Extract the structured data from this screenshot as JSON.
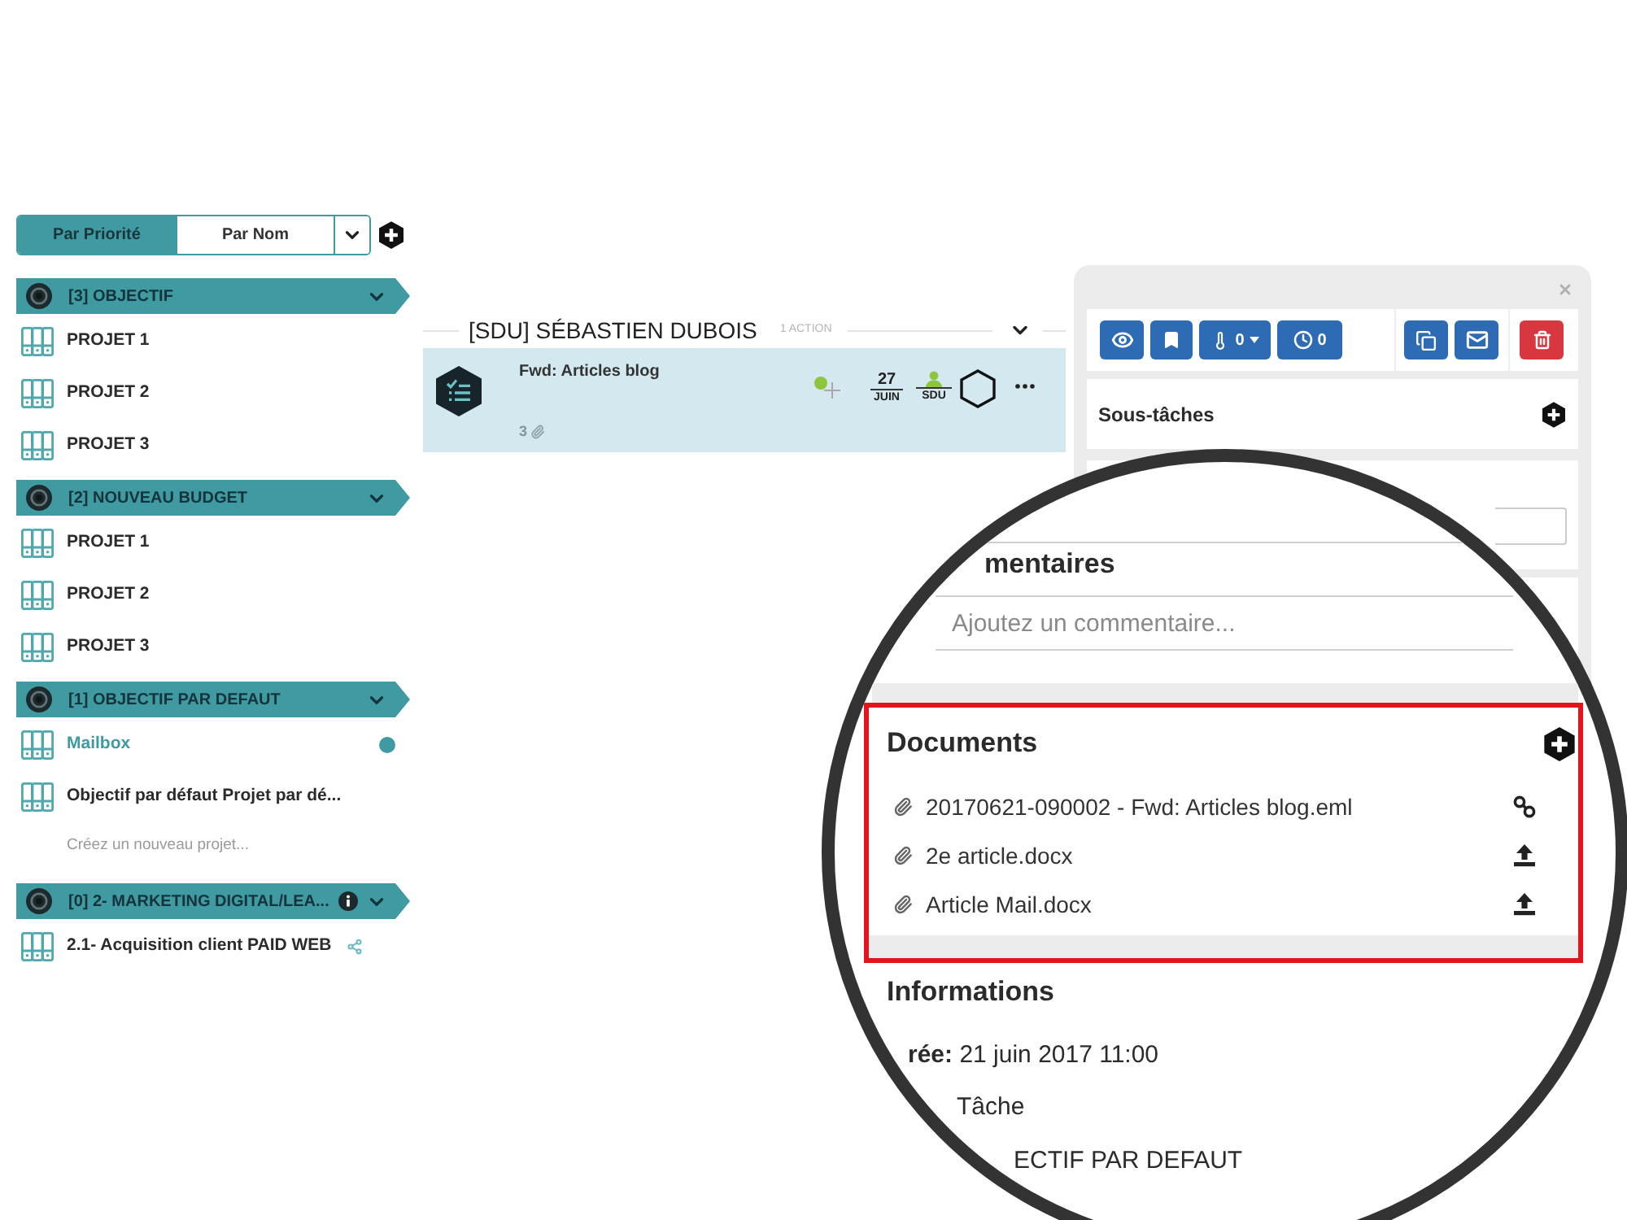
{
  "sort_toggle": [
    {
      "label": "Par Priorité",
      "selected": true
    },
    {
      "label": "Par Nom",
      "selected": false
    }
  ],
  "objectives": [
    {
      "label": "[3] OBJECTIF",
      "expanded": true,
      "info": false,
      "projects": [
        {
          "label": "PROJET 1",
          "selected": false,
          "shared": false
        },
        {
          "label": "PROJET 2",
          "selected": false,
          "shared": false
        },
        {
          "label": "PROJET 3",
          "selected": false,
          "shared": false
        }
      ]
    },
    {
      "label": "[2] NOUVEAU BUDGET",
      "expanded": true,
      "info": false,
      "projects": [
        {
          "label": "PROJET 1",
          "selected": false,
          "shared": false
        },
        {
          "label": "PROJET 2",
          "selected": false,
          "shared": false
        },
        {
          "label": "PROJET 3",
          "selected": false,
          "shared": false
        }
      ]
    },
    {
      "label": "[1] OBJECTIF PAR DEFAUT",
      "expanded": true,
      "info": false,
      "projects": [
        {
          "label": "Mailbox",
          "selected": true,
          "shared": false
        },
        {
          "label": "Objectif par défaut Projet par dé...",
          "selected": false,
          "shared": false
        }
      ],
      "create_link": "Créez un nouveau projet..."
    },
    {
      "label": "[0] 2- MARKETING DIGITAL/LEA...",
      "expanded": true,
      "info": true,
      "projects": [
        {
          "label": "2.1- Acquisition client PAID WEB",
          "selected": false,
          "shared": true
        }
      ]
    }
  ],
  "assignee": {
    "title": "[SDU] SÉBASTIEN DUBOIS",
    "count": "1 ACTION",
    "expanded": true,
    "tasks": [
      {
        "title": "Fwd: Articles blog",
        "attachments": "3",
        "due_day": "27",
        "due_month": "JUIN",
        "owner": "SDU",
        "selected": true,
        "done": false
      }
    ]
  },
  "detail_panel": {
    "priority": "0",
    "time": "0",
    "subtasks_title": "Sous-tâches"
  },
  "magnifier": {
    "comments_title": "mentaires",
    "comment_field": {
      "placeholder": "Ajoutez un commentaire..."
    },
    "documents": {
      "title": "Documents",
      "highlighted": true,
      "items": [
        {
          "name": "20170621-090002 - Fwd: Articles blog.eml",
          "kind": "link"
        },
        {
          "name": "2e article.docx",
          "kind": "upload"
        },
        {
          "name": "Article Mail.docx",
          "kind": "upload"
        }
      ]
    },
    "info_title": "Informations",
    "info_lines": [
      "**rée:** 21 juin 2017 11:00",
      "Tâche",
      "ECTIF PAR DEFAUT"
    ]
  }
}
